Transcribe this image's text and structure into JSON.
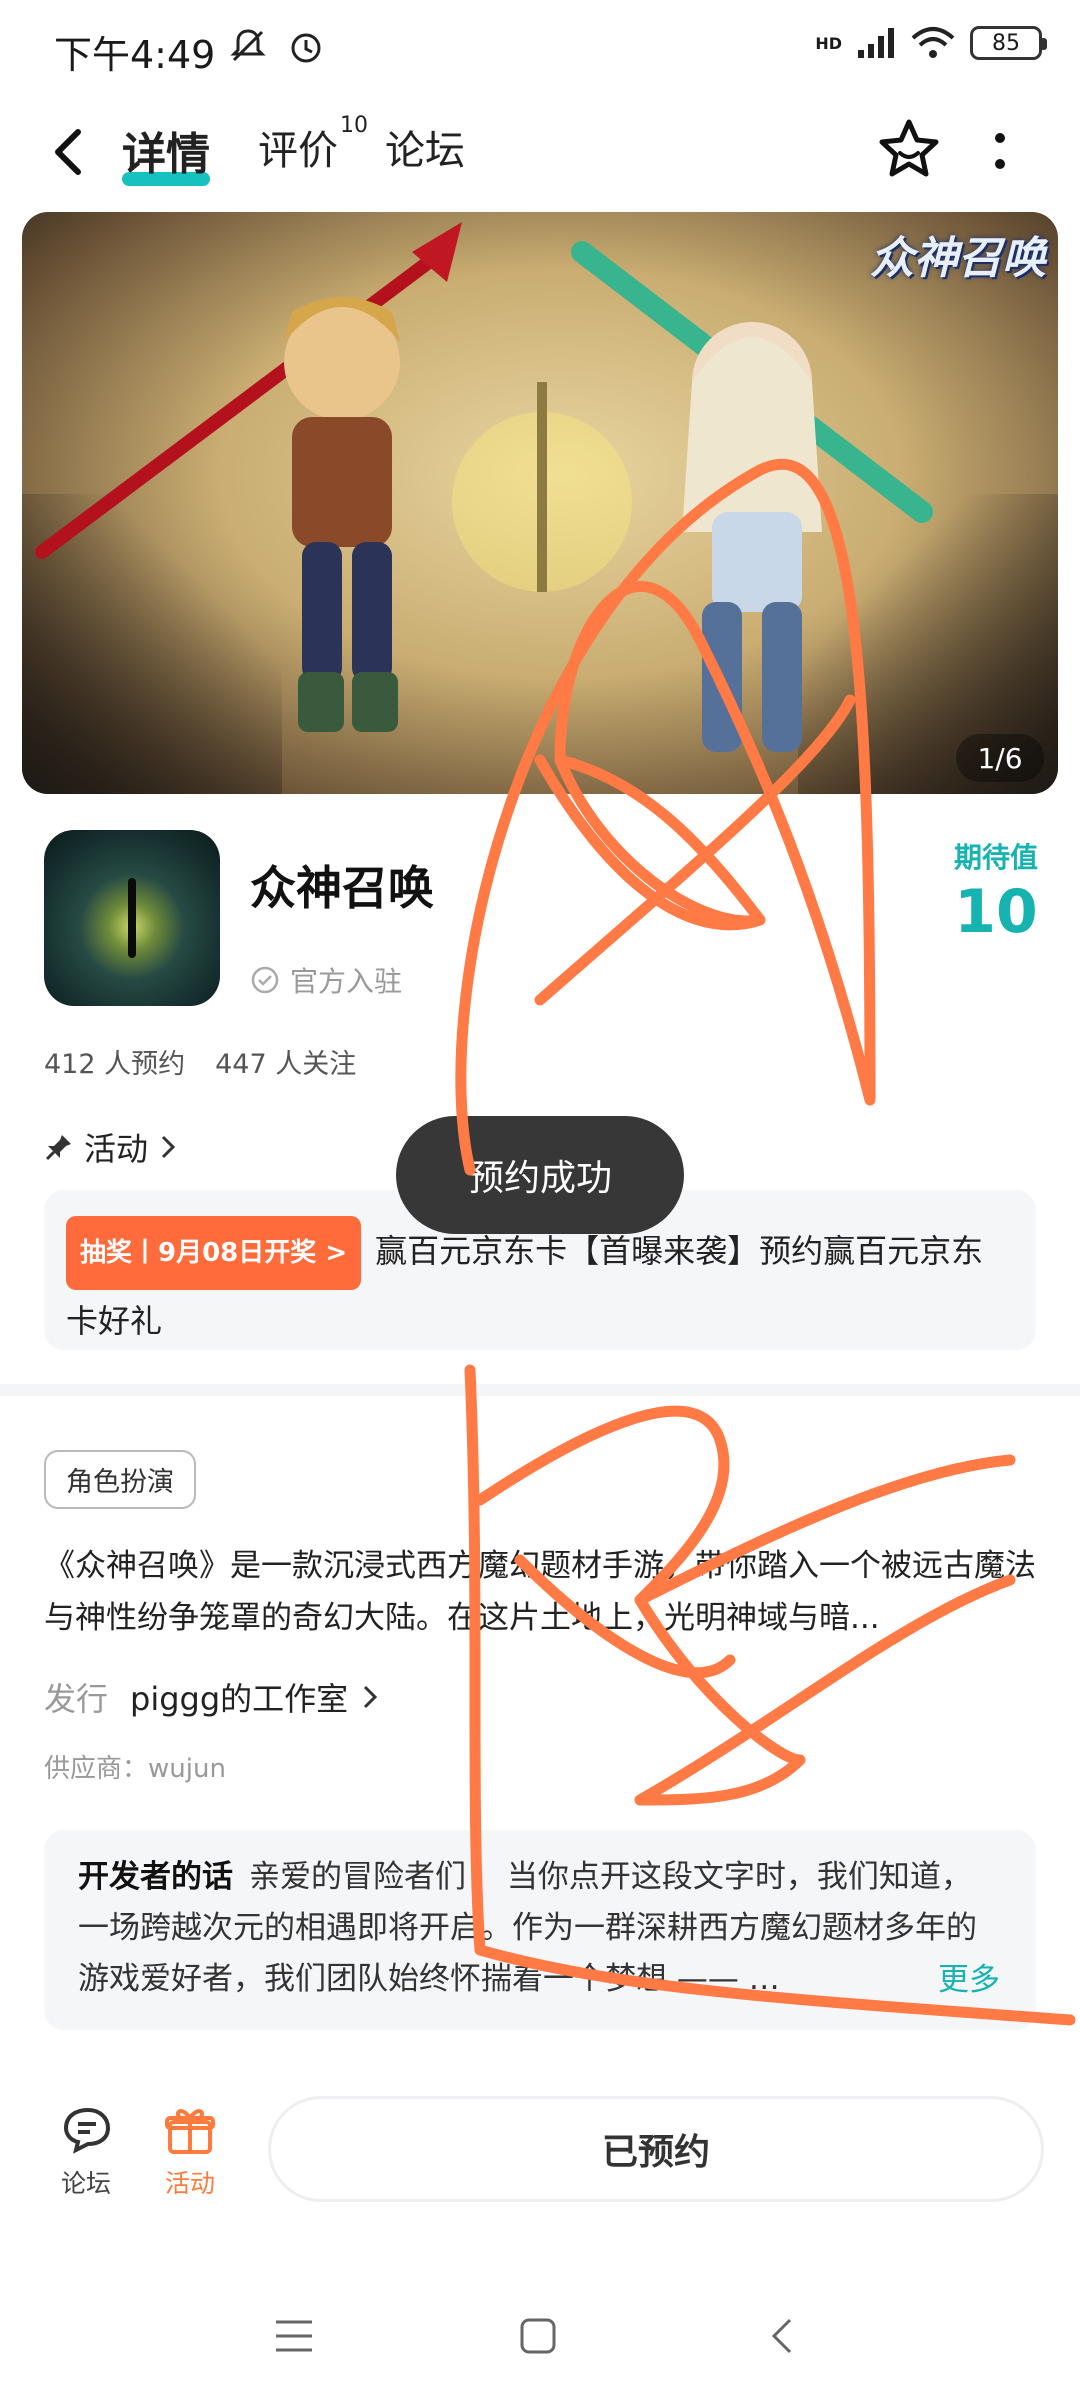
{
  "status_bar": {
    "time": "下午4:49",
    "network": "HD",
    "battery": "85"
  },
  "nav": {
    "tabs": [
      {
        "label": "详情",
        "active": true
      },
      {
        "label": "评价",
        "badge": "10"
      },
      {
        "label": "论坛"
      }
    ]
  },
  "banner": {
    "logo_text": "众神召唤",
    "counter": "1/6"
  },
  "app": {
    "title": "众神召唤",
    "official": "官方入驻",
    "expect_label": "期待值",
    "expect_value": "10",
    "reservations": "412 人预约",
    "followers": "447 人关注"
  },
  "activity": {
    "heading": "活动",
    "badge": "抽奖丨9月08日开奖 >",
    "text": "赢百元京东卡【首曝来袭】预约赢百元京东卡好礼"
  },
  "details": {
    "tag": "角色扮演",
    "description": "《众神召唤》是一款沉浸式西方魔幻题材手游，带你踏入一个被远古魔法与神性纷争笼罩的奇幻大陆。在这片土地上，光明神域与暗...",
    "publisher_label": "发行",
    "publisher_name": "piggg的工作室",
    "supplier": "供应商：wujun"
  },
  "developer": {
    "title": "开发者的话",
    "text": "亲爱的冒险者们：  当你点开这段文字时，我们知道，一场跨越次元的相遇即将开启。作为一群深耕西方魔幻题材多年的游戏爱好者，我们团队始终怀揣着一个梦想 —— …",
    "more": "更多"
  },
  "bottom_bar": {
    "forum": "论坛",
    "activity": "活动",
    "reserve_button": "已预约"
  },
  "toast": "预约成功",
  "colors": {
    "accent_teal": "#16b3b1",
    "accent_orange": "#ff6b3a",
    "scribble": "#ff7a45"
  }
}
